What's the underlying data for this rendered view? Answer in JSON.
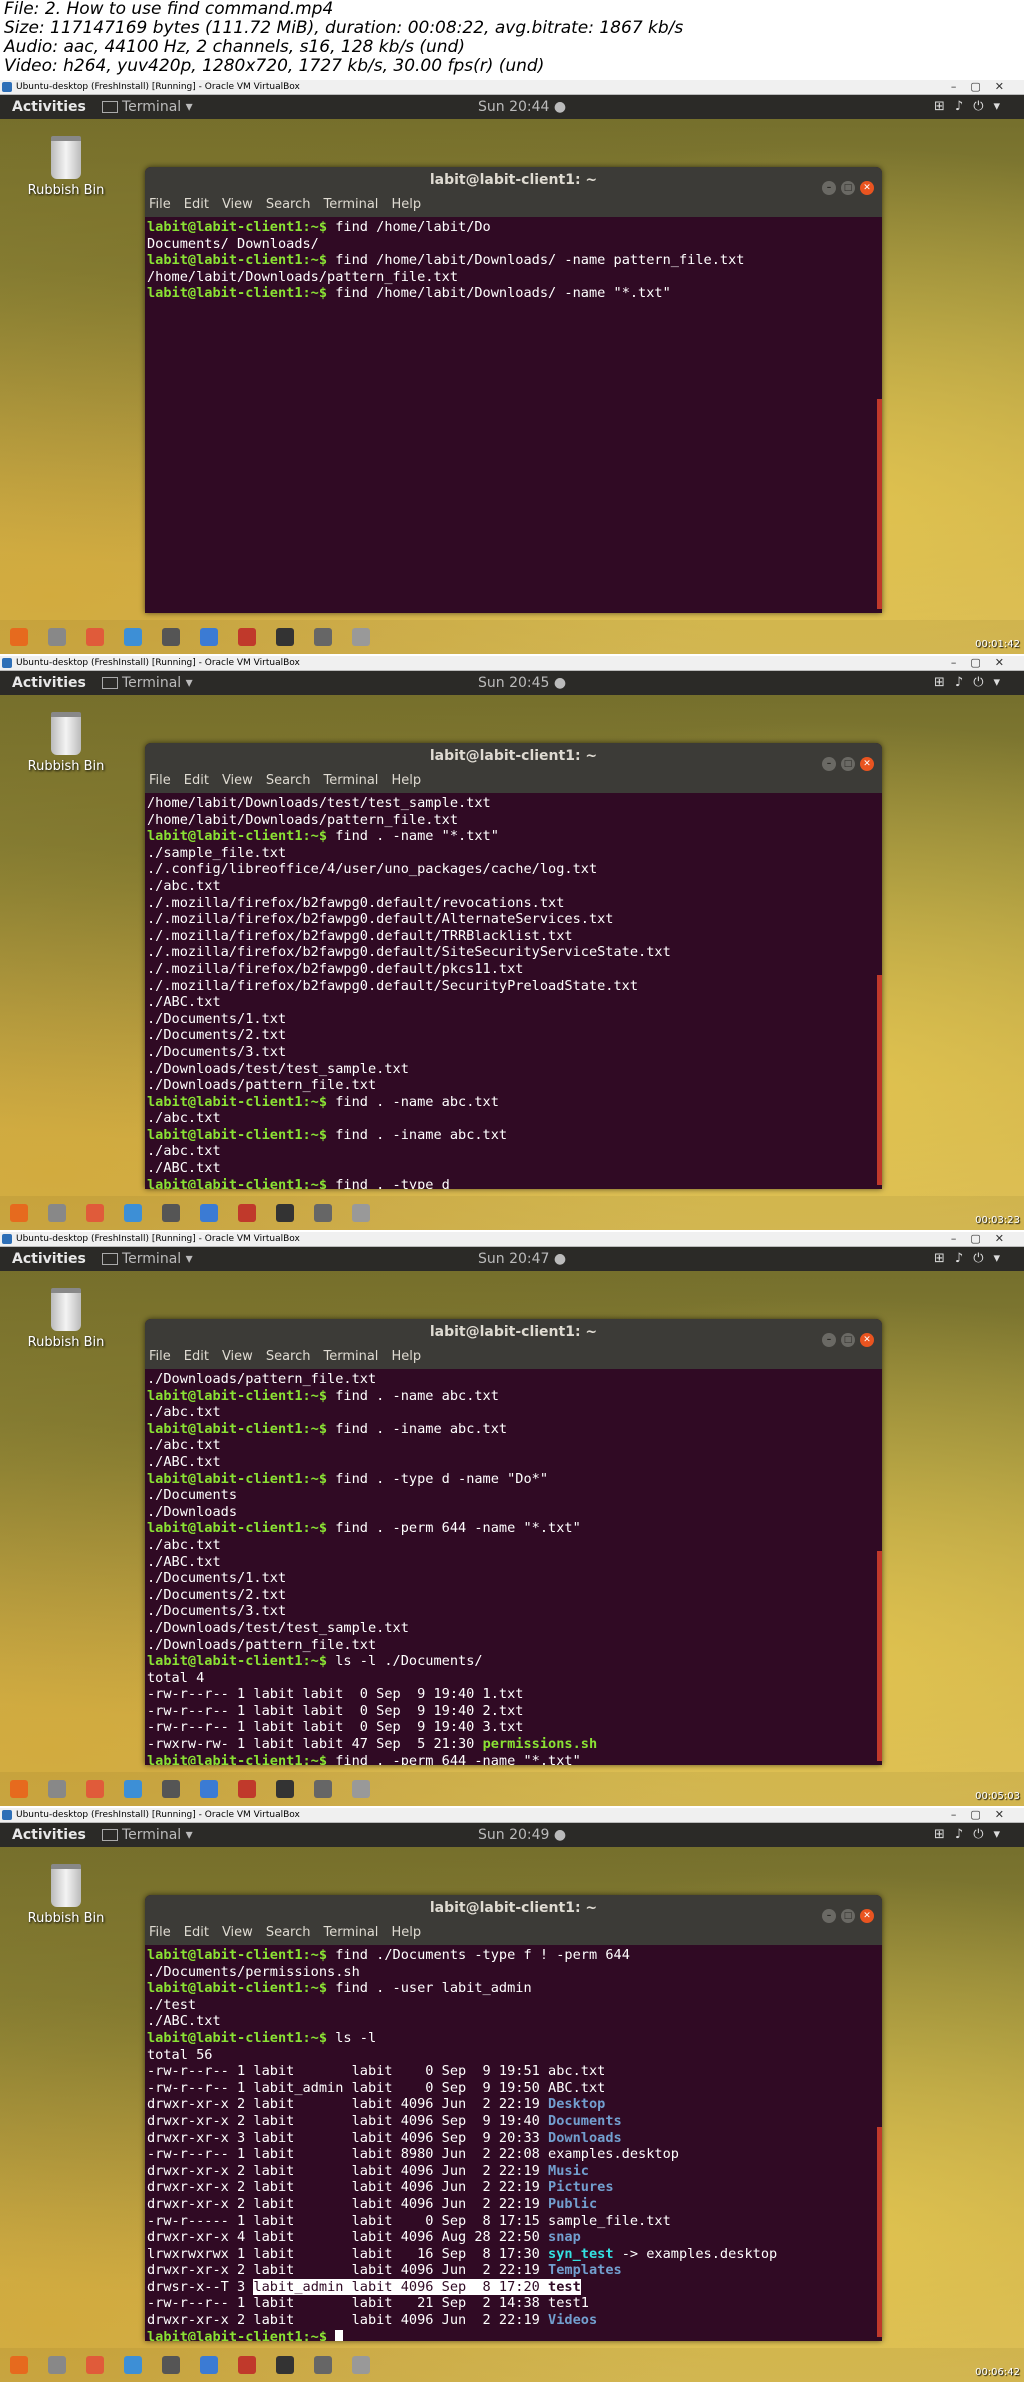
{
  "header": {
    "line1": "File: 2. How to use find command.mp4",
    "line2": "Size: 117147169 bytes (111.72 MiB), duration: 00:08:22, avg.bitrate: 1867 kb/s",
    "line3": "Audio: aac, 44100 Hz, 2 channels, s16, 128 kb/s (und)",
    "line4": "Video: h264, yuv420p, 1280x720, 1727 kb/s, 30.00 fps(r) (und)"
  },
  "common": {
    "vbox_title": "Ubuntu-desktop (FreshInstall) [Running] - Oracle VM VirtualBox",
    "activities": "Activities",
    "app_menu": "Terminal ▾",
    "desktop_icon": "Rubbish Bin",
    "term_title": "labit@labit-client1: ~",
    "menu": [
      "File",
      "Edit",
      "View",
      "Search",
      "Terminal",
      "Help"
    ],
    "prompt": "labit@labit-client1:~$"
  },
  "frames": [
    {
      "clock": "Sun 20:44 ●",
      "timestamp": "00:01:42",
      "lines": [
        {
          "p": true,
          "t": " find /home/labit/Do"
        },
        {
          "t": "Documents/ Downloads/"
        },
        {
          "p": true,
          "t": " find /home/labit/Downloads/ -name pattern_file.txt"
        },
        {
          "t": "/home/labit/Downloads/pattern_file.txt"
        },
        {
          "p": true,
          "t": " find /home/labit/Downloads/ -name \"*.txt\""
        }
      ]
    },
    {
      "clock": "Sun 20:45 ●",
      "timestamp": "00:03:23",
      "lines": [
        {
          "t": "/home/labit/Downloads/test/test_sample.txt"
        },
        {
          "t": "/home/labit/Downloads/pattern_file.txt"
        },
        {
          "p": true,
          "t": " find . -name \"*.txt\""
        },
        {
          "t": "./sample_file.txt"
        },
        {
          "t": "./.config/libreoffice/4/user/uno_packages/cache/log.txt"
        },
        {
          "t": "./abc.txt"
        },
        {
          "t": "./.mozilla/firefox/b2fawpg0.default/revocations.txt"
        },
        {
          "t": "./.mozilla/firefox/b2fawpg0.default/AlternateServices.txt"
        },
        {
          "t": "./.mozilla/firefox/b2fawpg0.default/TRRBlacklist.txt"
        },
        {
          "t": "./.mozilla/firefox/b2fawpg0.default/SiteSecurityServiceState.txt"
        },
        {
          "t": "./.mozilla/firefox/b2fawpg0.default/pkcs11.txt"
        },
        {
          "t": "./.mozilla/firefox/b2fawpg0.default/SecurityPreloadState.txt"
        },
        {
          "t": "./ABC.txt"
        },
        {
          "t": "./Documents/1.txt"
        },
        {
          "t": "./Documents/2.txt"
        },
        {
          "t": "./Documents/3.txt"
        },
        {
          "t": "./Downloads/test/test_sample.txt"
        },
        {
          "t": "./Downloads/pattern_file.txt"
        },
        {
          "p": true,
          "t": " find . -name abc.txt"
        },
        {
          "t": "./abc.txt"
        },
        {
          "p": true,
          "t": " find . -iname abc.txt"
        },
        {
          "t": "./abc.txt"
        },
        {
          "t": "./ABC.txt"
        },
        {
          "p": true,
          "t": " find . -type d"
        }
      ]
    },
    {
      "clock": "Sun 20:47 ●",
      "timestamp": "00:05:03",
      "lines": [
        {
          "t": "./Downloads/pattern_file.txt"
        },
        {
          "p": true,
          "t": " find . -name abc.txt"
        },
        {
          "t": "./abc.txt"
        },
        {
          "p": true,
          "t": " find . -iname abc.txt"
        },
        {
          "t": "./abc.txt"
        },
        {
          "t": "./ABC.txt"
        },
        {
          "p": true,
          "t": " find . -type d -name \"Do*\""
        },
        {
          "t": "./Documents"
        },
        {
          "t": "./Downloads"
        },
        {
          "p": true,
          "t": " find . -perm 644 -name \"*.txt\""
        },
        {
          "t": "./abc.txt"
        },
        {
          "t": "./ABC.txt"
        },
        {
          "t": "./Documents/1.txt"
        },
        {
          "t": "./Documents/2.txt"
        },
        {
          "t": "./Documents/3.txt"
        },
        {
          "t": "./Downloads/test/test_sample.txt"
        },
        {
          "t": "./Downloads/pattern_file.txt"
        },
        {
          "p": true,
          "t": " ls -l ./Documents/"
        },
        {
          "t": "total 4"
        },
        {
          "t": "-rw-r--r-- 1 labit labit  0 Sep  9 19:40 1.txt"
        },
        {
          "t": "-rw-r--r-- 1 labit labit  0 Sep  9 19:40 2.txt"
        },
        {
          "t": "-rw-r--r-- 1 labit labit  0 Sep  9 19:40 3.txt"
        },
        {
          "t": "-rwxrw-rw- 1 labit labit 47 Sep  5 21:30 ",
          "g": "permissions.sh"
        },
        {
          "p": true,
          "t": " find . -perm 644 -name \"*.txt\""
        }
      ]
    },
    {
      "clock": "Sun 20:49 ●",
      "timestamp": "00:06:42",
      "lines": [
        {
          "p": true,
          "t": " find ./Documents -type f ! -perm 644"
        },
        {
          "t": "./Documents/permissions.sh"
        },
        {
          "p": true,
          "t": " find . -user labit_admin"
        },
        {
          "t": "./test"
        },
        {
          "t": "./ABC.txt"
        },
        {
          "p": true,
          "t": " ls -l"
        },
        {
          "t": "total 56"
        },
        {
          "t": "-rw-r--r-- 1 labit       labit    0 Sep  9 19:51 abc.txt"
        },
        {
          "t": "-rw-r--r-- 1 labit_admin labit    0 Sep  9 19:50 ABC.txt"
        },
        {
          "t": "drwxr-xr-x 2 labit       labit 4096 Jun  2 22:19 ",
          "b": "Desktop"
        },
        {
          "t": "drwxr-xr-x 2 labit       labit 4096 Sep  9 19:40 ",
          "b": "Documents"
        },
        {
          "t": "drwxr-xr-x 3 labit       labit 4096 Sep  9 20:33 ",
          "b": "Downloads"
        },
        {
          "t": "-rw-r--r-- 1 labit       labit 8980 Jun  2 22:08 examples.desktop"
        },
        {
          "t": "drwxr-xr-x 2 labit       labit 4096 Jun  2 22:19 ",
          "b": "Music"
        },
        {
          "t": "drwxr-xr-x 2 labit       labit 4096 Jun  2 22:19 ",
          "b": "Pictures"
        },
        {
          "t": "drwxr-xr-x 2 labit       labit 4096 Jun  2 22:19 ",
          "b": "Public"
        },
        {
          "t": "-rw-r----- 1 labit       labit    0 Sep  8 17:15 sample_file.txt"
        },
        {
          "t": "drwxr-xr-x 4 labit       labit 4096 Aug 28 22:50 ",
          "b": "snap"
        },
        {
          "t": "lrwxrwxrwx 1 labit       labit   16 Sep  8 17:30 ",
          "c": "syn_test",
          "r": " -> examples.desktop"
        },
        {
          "t": "drwxr-xr-x 2 labit       labit 4096 Jun  2 22:19 ",
          "b": "Templates"
        },
        {
          "t": "drwsr-x--T 3 ",
          "h": "labit_admin labit 4096 Sep  8 17:20 ",
          "hb": "test"
        },
        {
          "t": "-rw-r--r-- 1 labit       labit   21 Sep  2 14:38 test1"
        },
        {
          "t": "drwxr-xr-x 2 labit       labit 4096 Jun  2 22:19 ",
          "b": "Videos"
        },
        {
          "p": true,
          "t": " ",
          "cur": true
        }
      ]
    }
  ]
}
